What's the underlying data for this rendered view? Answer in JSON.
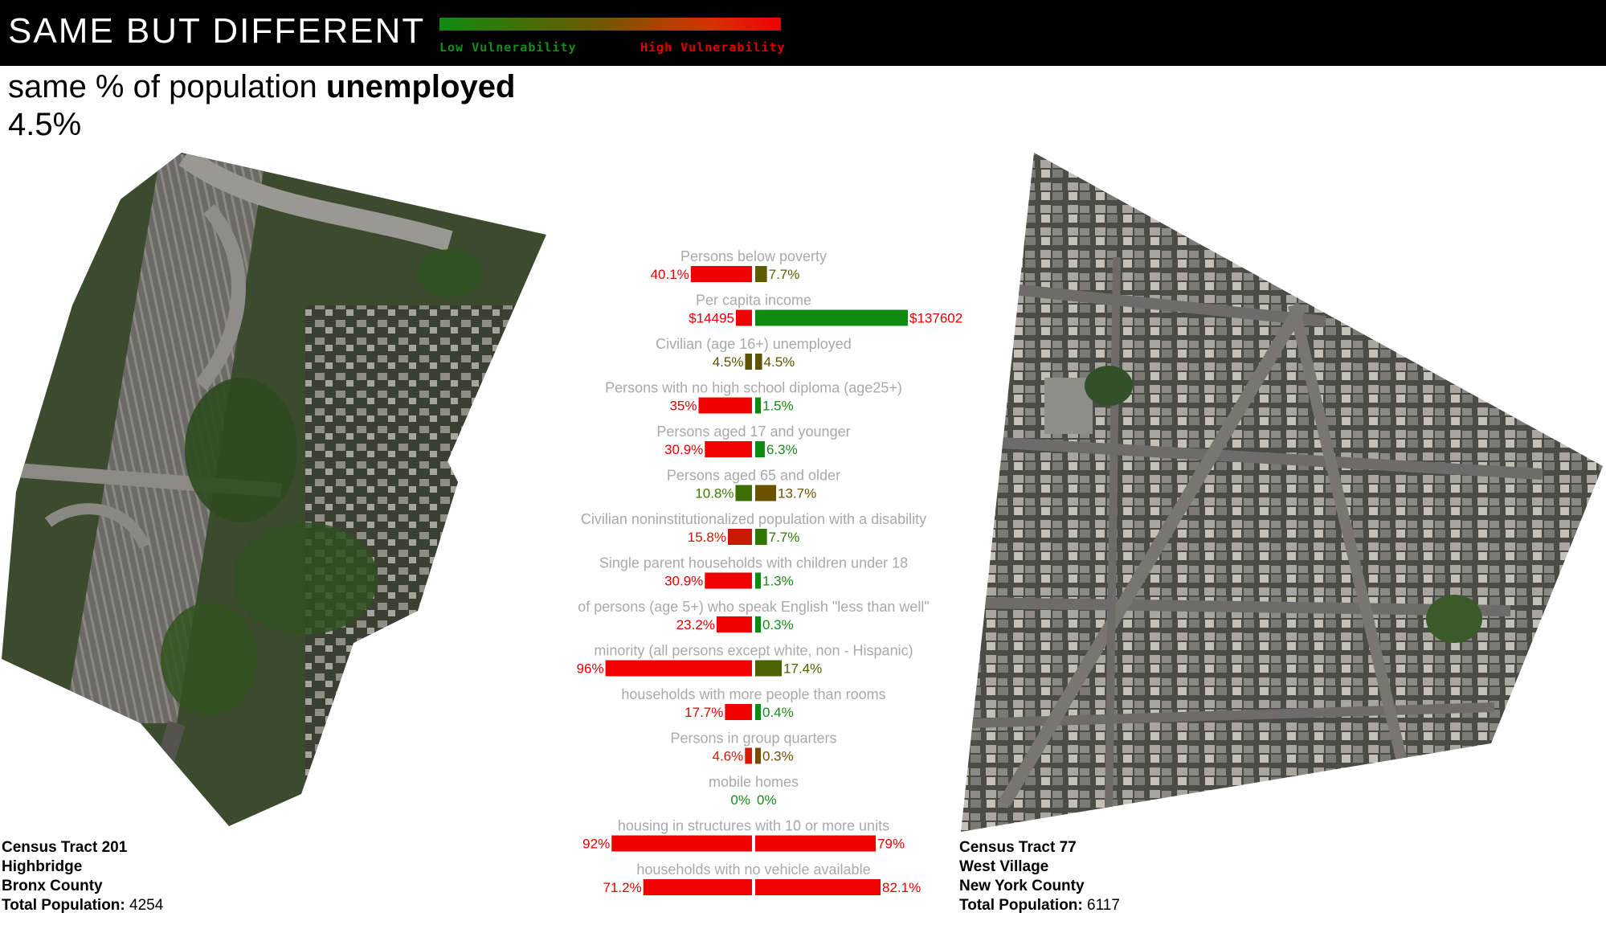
{
  "header": {
    "title": "SAME BUT DIFFERENT",
    "legend": {
      "low_label": "Low Vulnerability",
      "high_label": "High Vulnerability",
      "low_color": "#1a8a1a",
      "high_color": "#f00000"
    }
  },
  "subtitle": {
    "prefix": "same % of population ",
    "metric": "unemployed",
    "value": "4.5%"
  },
  "left_tract": {
    "tract": "Census Tract 201",
    "neighborhood": "Highbridge",
    "county": "Bronx County",
    "population_label": "Total Population:",
    "population_value": "4254"
  },
  "right_tract": {
    "tract": "Census Tract 77",
    "neighborhood": "West Village",
    "county": "New York County",
    "population_label": "Total Population:",
    "population_value": "6117"
  },
  "chart_data": {
    "type": "bar",
    "orientation": "diverging-horizontal",
    "series": [
      {
        "name": "Census Tract 201",
        "side": "left"
      },
      {
        "name": "Census Tract 77",
        "side": "right"
      }
    ],
    "rows": [
      {
        "label": "Persons below poverty",
        "left_text": "40.1%",
        "right_text": "7.7%",
        "left": 40.1,
        "right": 7.7,
        "left_color": "#f00000",
        "right_color": "#5e5a00",
        "right_text_color": "#5e5a00"
      },
      {
        "label": "Per capita income",
        "left_text": "$14495",
        "right_text": "$137602",
        "left": 14495,
        "right": 137602,
        "left_color": "#f00000",
        "right_color": "#0f8a10",
        "right_text_color": "#e00000"
      },
      {
        "label": "Civilian (age 16+) unemployed",
        "left_text": "4.5%",
        "right_text": "4.5%",
        "left": 4.5,
        "right": 4.5,
        "left_color": "#5e5200",
        "right_color": "#5e5200",
        "left_text_color": "#5e5200",
        "right_text_color": "#5e5200"
      },
      {
        "label": "Persons with no high school diploma (age25+)",
        "left_text": "35%",
        "right_text": "1.5%",
        "left": 35,
        "right": 1.5,
        "left_color": "#f00000",
        "right_color": "#0f8a10",
        "right_text_color": "#1a8a1a"
      },
      {
        "label": "Persons aged 17 and younger",
        "left_text": "30.9%",
        "right_text": "6.3%",
        "left": 30.9,
        "right": 6.3,
        "left_color": "#f00000",
        "right_color": "#0f8a10",
        "right_text_color": "#1a8a1a"
      },
      {
        "label": "Persons aged 65 and older",
        "left_text": "10.8%",
        "right_text": "13.7%",
        "left": 10.8,
        "right": 13.7,
        "left_color": "#3c6e00",
        "right_color": "#6a5200",
        "left_text_color": "#3c7a00",
        "right_text_color": "#6a5200"
      },
      {
        "label": "Civilian noninstitutionalized population with a disability",
        "left_text": "15.8%",
        "right_text": "7.7%",
        "left": 15.8,
        "right": 7.7,
        "left_color": "#c81a00",
        "right_color": "#2e7600",
        "left_text_color": "#c81a00",
        "right_text_color": "#2e7600"
      },
      {
        "label": "Single parent households with children under 18",
        "left_text": "30.9%",
        "right_text": "1.3%",
        "left": 30.9,
        "right": 1.3,
        "left_color": "#f00000",
        "right_color": "#0f8a10",
        "right_text_color": "#1a8a1a"
      },
      {
        "label": "of persons (age 5+) who speak English \"less than well\"",
        "left_text": "23.2%",
        "right_text": "0.3%",
        "left": 23.2,
        "right": 0.3,
        "left_color": "#f00000",
        "right_color": "#0f8a10",
        "right_text_color": "#1a8a1a"
      },
      {
        "label": "minority (all persons except white, non - Hispanic)",
        "left_text": "96%",
        "right_text": "17.4%",
        "left": 96,
        "right": 17.4,
        "left_color": "#f00000",
        "right_color": "#4a6200",
        "right_text_color": "#4a6200"
      },
      {
        "label": "households with more people than rooms",
        "left_text": "17.7%",
        "right_text": "0.4%",
        "left": 17.7,
        "right": 0.4,
        "left_color": "#f00000",
        "right_color": "#0f8a10",
        "right_text_color": "#1a8a1a"
      },
      {
        "label": "Persons in group quarters",
        "left_text": "4.6%",
        "right_text": "0.3%",
        "left": 4.6,
        "right": 0.3,
        "left_color": "#d81800",
        "right_color": "#7a4a00",
        "left_text_color": "#d81800",
        "right_text_color": "#7a4a00"
      },
      {
        "label": "mobile homes",
        "left_text": "0%",
        "right_text": "0%",
        "left": 0,
        "right": 0,
        "left_color": "#1a8a1a",
        "right_color": "#1a8a1a",
        "left_text_color": "#1a8a1a",
        "right_text_color": "#1a8a1a"
      },
      {
        "label": "housing in structures with 10 or more units",
        "left_text": "92%",
        "right_text": "79%",
        "left": 92,
        "right": 79,
        "left_color": "#f00000",
        "right_color": "#f00000",
        "right_text_color": "#e00000"
      },
      {
        "label": "households with no vehicle available",
        "left_text": "71.2%",
        "right_text": "82.1%",
        "left": 71.2,
        "right": 82.1,
        "left_color": "#f00000",
        "right_color": "#f00000",
        "right_text_color": "#e00000"
      }
    ]
  }
}
